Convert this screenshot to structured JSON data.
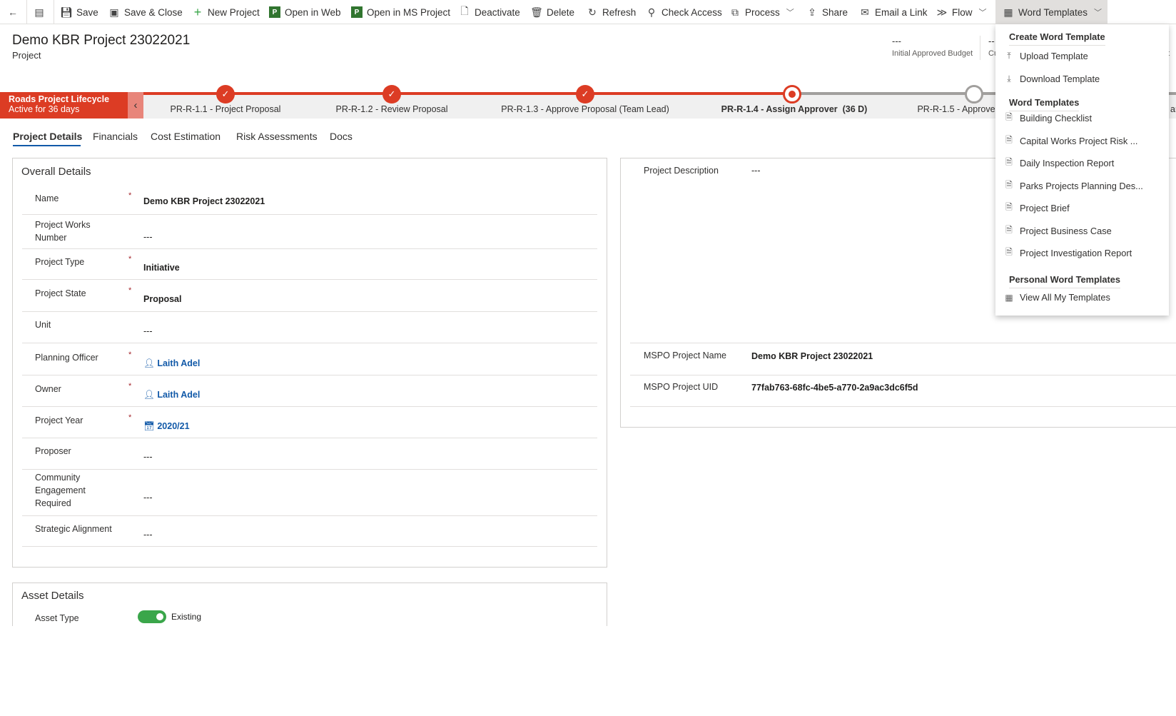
{
  "toolbar": {
    "items": [
      {
        "label": "",
        "icon": "back-arrow-icon"
      },
      {
        "label": "",
        "icon": "form-icon"
      },
      {
        "label": "Save",
        "icon": "save-icon"
      },
      {
        "label": "Save & Close",
        "icon": "save-close-icon"
      },
      {
        "label": "New Project",
        "icon": "plus-icon"
      },
      {
        "label": "Open in Web",
        "icon": "ms-project-icon"
      },
      {
        "label": "Open in MS Project",
        "icon": "ms-project-icon"
      },
      {
        "label": "Deactivate",
        "icon": "deactivate-icon"
      },
      {
        "label": "Delete",
        "icon": "trash-icon"
      },
      {
        "label": "Refresh",
        "icon": "refresh-icon"
      },
      {
        "label": "Check Access",
        "icon": "check-access-icon"
      },
      {
        "label": "Process",
        "icon": "process-icon"
      },
      {
        "label": "Share",
        "icon": "share-icon"
      },
      {
        "label": "Email a Link",
        "icon": "email-icon"
      },
      {
        "label": "Flow",
        "icon": "flow-icon"
      },
      {
        "label": "Word Templates",
        "icon": "word-icon"
      }
    ]
  },
  "header": {
    "title": "Demo KBR Project 23022021",
    "entity": "Project",
    "kpis": [
      {
        "value": "---",
        "label": "Initial Approved Budget"
      },
      {
        "value": "--",
        "label": "Cu"
      }
    ],
    "partial_right": "et S"
  },
  "process": {
    "name": "Roads Project Lifecycle",
    "status": "Active for 36 days",
    "accent": "#dc3c24",
    "stages": [
      {
        "label": "PR-R-1.1 - Project Proposal",
        "state": "done"
      },
      {
        "label": "PR-R-1.2 - Review Proposal",
        "state": "done"
      },
      {
        "label": "PR-R-1.3 - Approve Proposal (Team Lead)",
        "state": "done"
      },
      {
        "label": "PR-R-1.4 - Assign Approver  (36 D)",
        "state": "active"
      },
      {
        "label": "PR-R-1.5 - Approve",
        "state": "pending"
      }
    ],
    "partial_right": "ar"
  },
  "tabs": [
    "Project Details",
    "Financials",
    "Cost Estimation",
    "Risk Assessments",
    "Docs"
  ],
  "overall": {
    "title": "Overall Details",
    "fields": [
      {
        "label": "Name",
        "req": "*",
        "value": "Demo KBR Project 23022021"
      },
      {
        "label": "Project Works Number",
        "req": "",
        "value": "---"
      },
      {
        "label": "Project Type",
        "req": "*",
        "value": "Initiative"
      },
      {
        "label": "Project State",
        "req": "*",
        "value": "Proposal"
      },
      {
        "label": "Unit",
        "req": "",
        "value": "---"
      },
      {
        "label": "Planning Officer",
        "req": "*",
        "value": "Laith Adel"
      },
      {
        "label": "Owner",
        "req": "*",
        "value": "Laith Adel"
      },
      {
        "label": "Project Year",
        "req": "*",
        "value": "2020/21"
      },
      {
        "label": "Proposer",
        "req": "",
        "value": "---"
      },
      {
        "label": "Community Engagement Required",
        "req": "",
        "value": "---"
      },
      {
        "label": "Strategic Alignment",
        "req": "",
        "value": "---"
      }
    ]
  },
  "right": {
    "description_label": "Project Description",
    "description_value": "---",
    "mspo_name_label": "MSPO Project Name",
    "mspo_name": "Demo KBR Project 23022021",
    "mspo_uid_label": "MSPO Project UID",
    "mspo_uid": "77fab763-68fc-4be5-a770-2a9ac3dc6f5d"
  },
  "asset": {
    "title": "Asset Details",
    "type_label": "Asset Type",
    "type_value": "Existing",
    "toggle_on": true
  },
  "dropdown": {
    "create_header": "Create Word Template",
    "upload": "Upload Template",
    "download": "Download Template",
    "templates_header": "Word Templates",
    "templates": [
      "Building Checklist",
      "Capital Works Project Risk ...",
      "Daily Inspection Report",
      "Parks Projects Planning Des...",
      "Project Brief",
      "Project Business Case",
      "Project Investigation Report"
    ],
    "personal_header": "Personal Word Templates",
    "view_all": "View All My Templates"
  }
}
